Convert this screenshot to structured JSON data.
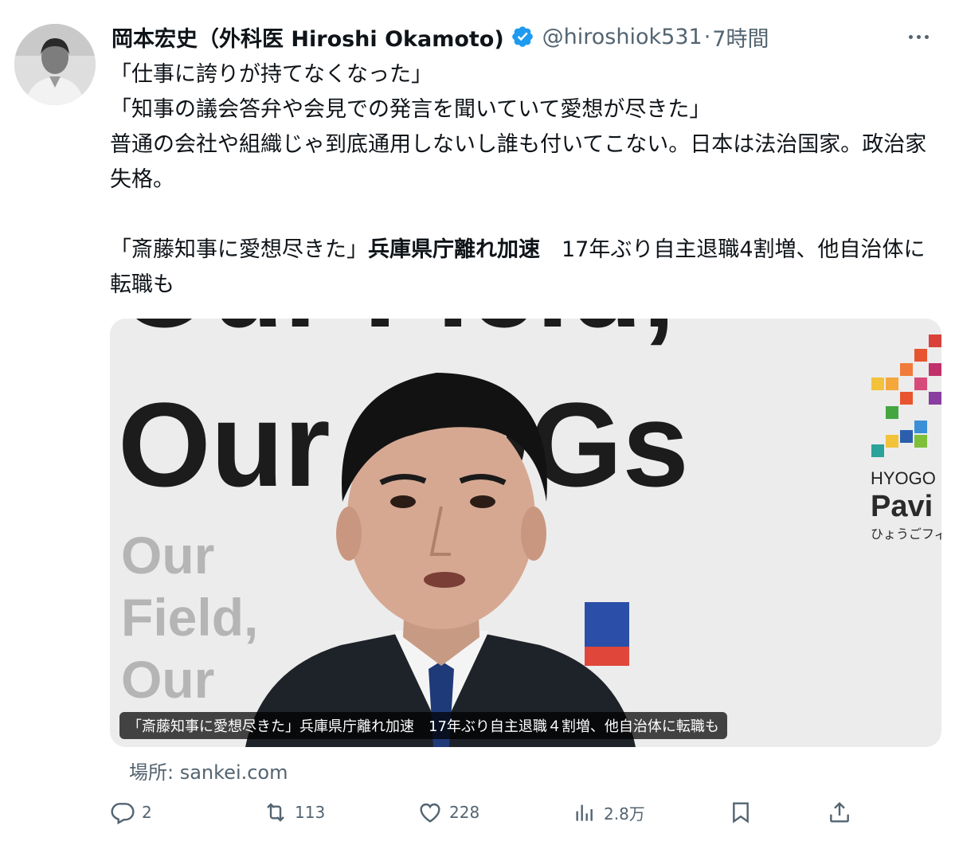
{
  "author": {
    "display_name": "岡本宏史（外科医 Hiroshi Okamoto)",
    "handle": "@hiroshiok531",
    "separator": "·",
    "time": "7時間",
    "verified": true
  },
  "body": {
    "line1": "「仕事に誇りが持てなくなった」",
    "line2": "「知事の議会答弁や会見での発言を聞いていて愛想が尽きた」",
    "line3": "普通の会社や組織じゃ到底通用しないし誰も付いてこない。日本は法治国家。政治家失格。",
    "quote_a": "「斎藤知事に愛想尽きた」",
    "quote_b": "兵庫県庁離れ加速",
    "quote_c": "　17年ぶり自主退職4割増、他自治体に転職も"
  },
  "media": {
    "backdrop_big": "Our Field, Our SDGs",
    "backdrop_small": "Our Field, Our SDGs",
    "logo_text_1": "HYOGO F",
    "logo_text_2": "Pavi",
    "logo_text_3": "ひょうごフィー",
    "caption": "「斎藤知事に愛想尽きた」兵庫県庁離れ加速　17年ぶり自主退職４割増、他自治体に転職も"
  },
  "source": "場所: sankei.com",
  "actions": {
    "replies": "2",
    "retweets": "113",
    "likes": "228",
    "views": "2.8万"
  },
  "colors": {
    "text": "#0f1419",
    "secondary": "#536471",
    "verified": "#1d9bf0"
  }
}
